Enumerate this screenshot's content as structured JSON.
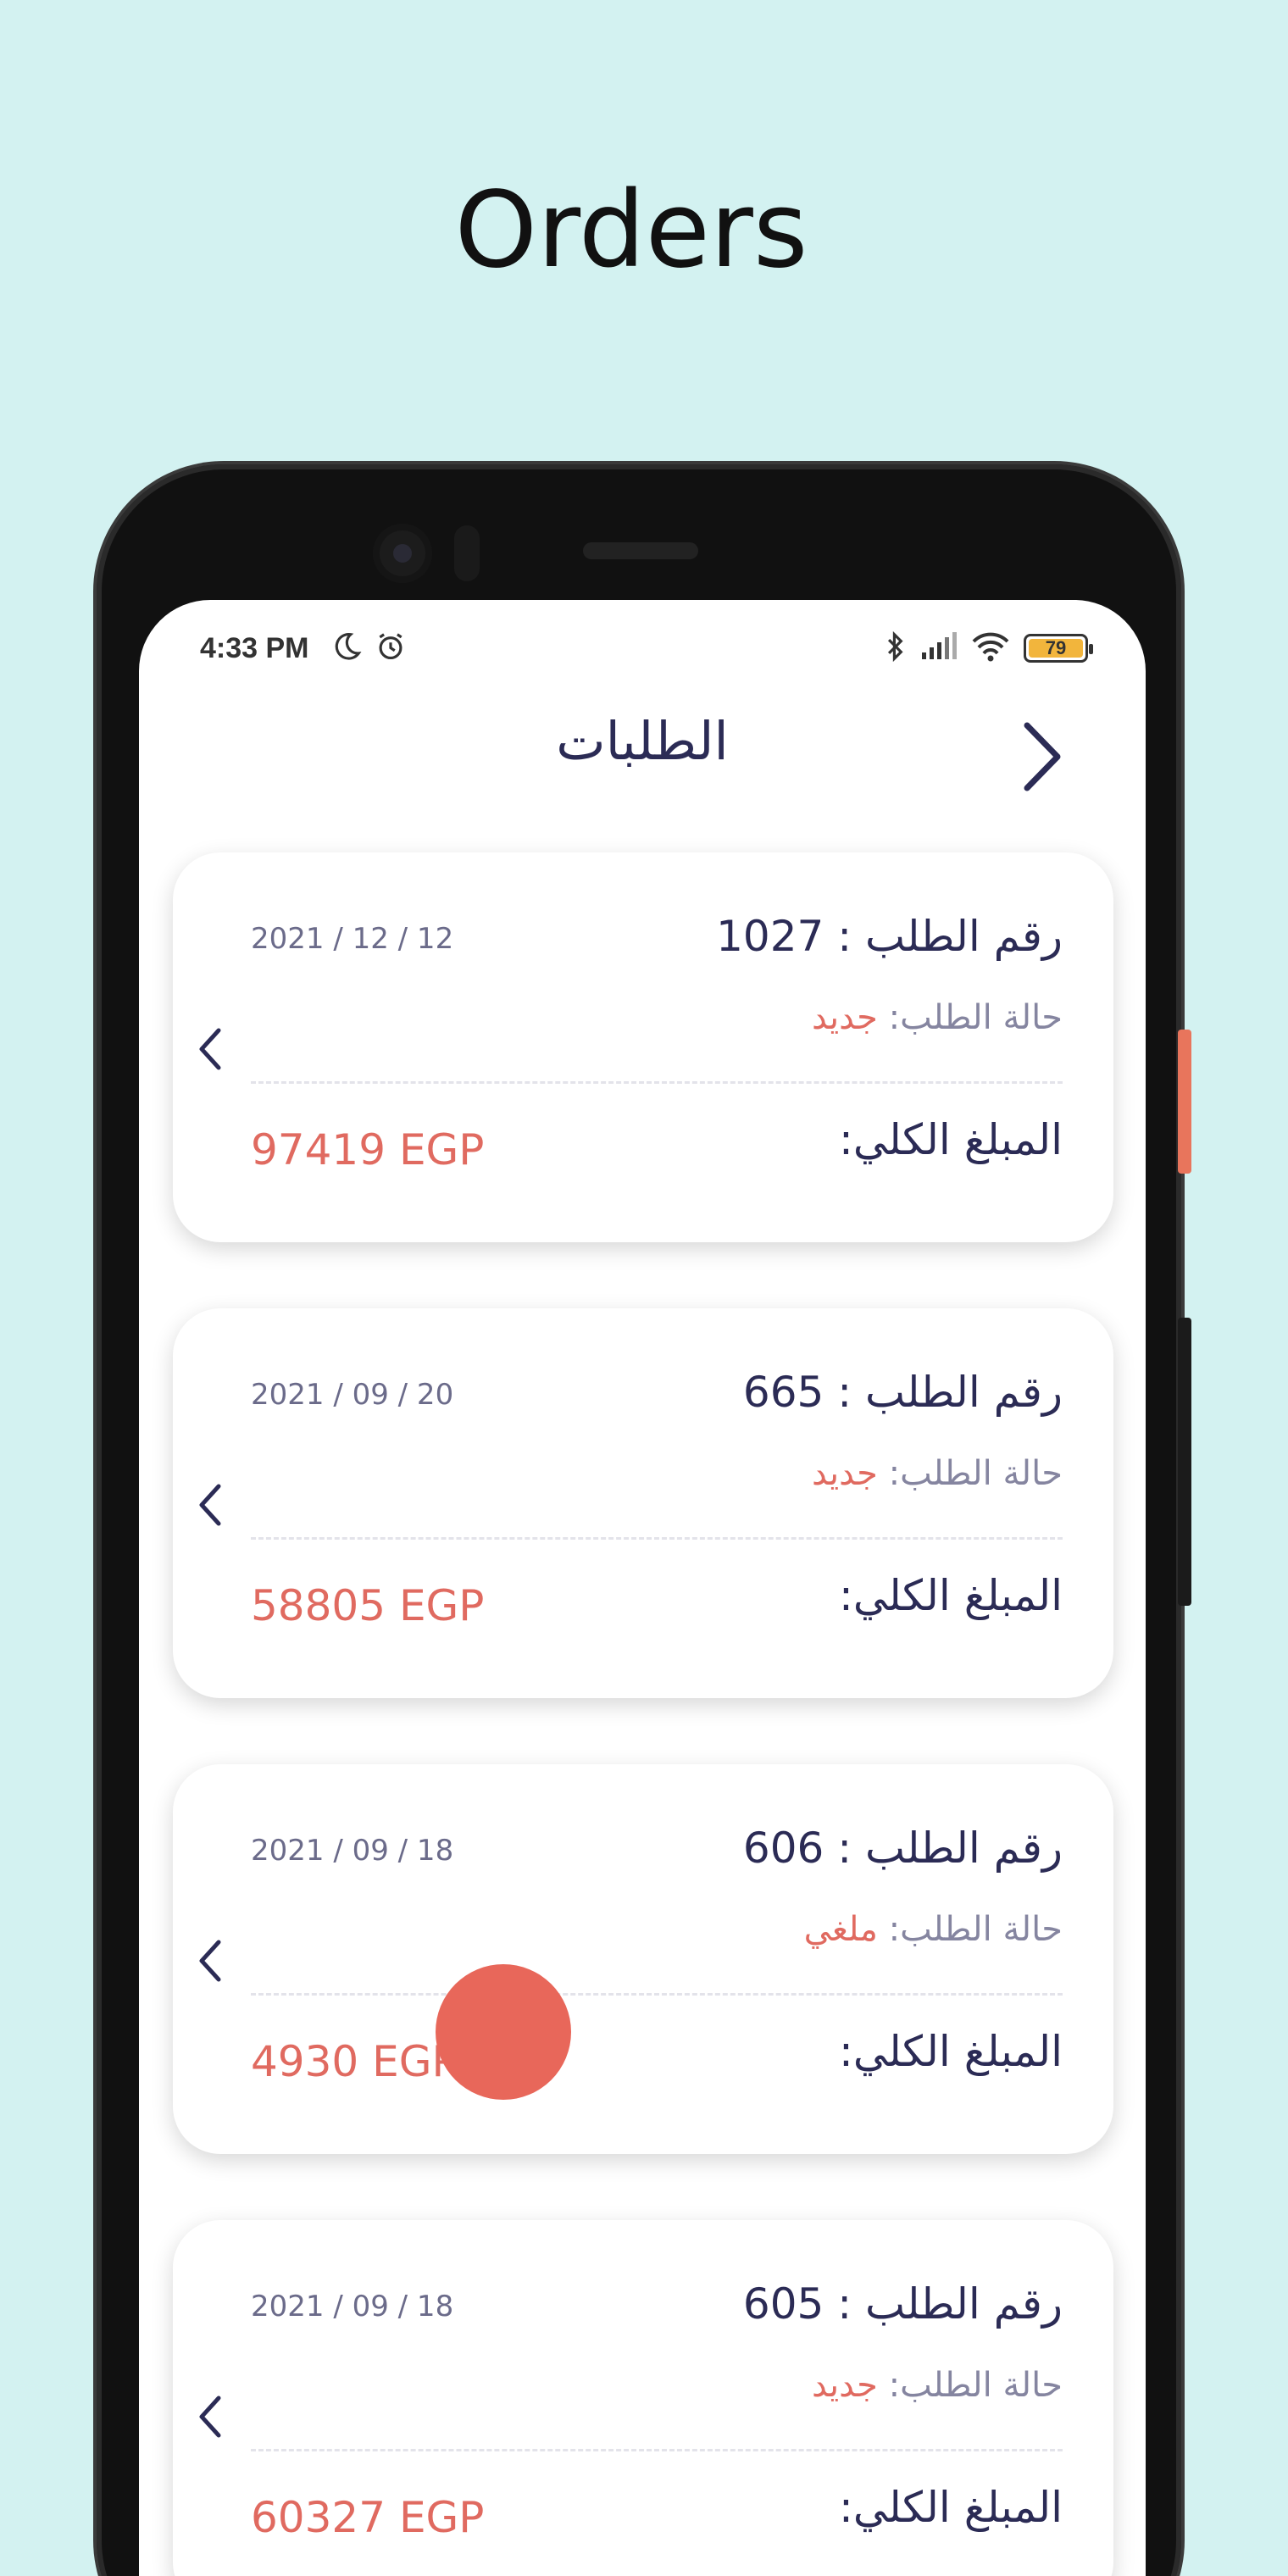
{
  "promo": {
    "title": "Orders"
  },
  "status_bar": {
    "time": "4:33 PM",
    "battery": "79",
    "icons_left": [
      "moon-icon",
      "alarm-icon"
    ],
    "icons_right": [
      "bluetooth-icon",
      "signal-icon",
      "wifi-icon",
      "battery-icon"
    ]
  },
  "app_bar": {
    "title": "الطلبات",
    "back_icon": "chevron-right-icon"
  },
  "labels": {
    "order_number": "رقم الطلب :",
    "order_status": "حالة الطلب:",
    "total": "المبلغ الكلي:"
  },
  "orders": [
    {
      "number": "1027",
      "date": "2021 / 12 / 12",
      "status": "جديد",
      "total": "97419 EGP"
    },
    {
      "number": "665",
      "date": "2021 / 09 / 20",
      "status": "جديد",
      "total": "58805 EGP"
    },
    {
      "number": "606",
      "date": "2021 / 09 / 18",
      "status": "ملغي",
      "total": "4930 EGP"
    },
    {
      "number": "605",
      "date": "2021 / 09 / 18",
      "status": "جديد",
      "total": "60327 EGP"
    }
  ],
  "colors": {
    "background": "#d3f2f1",
    "accent": "#e06a60",
    "primary_text": "#2b2b55",
    "secondary_text": "#8585a0"
  }
}
